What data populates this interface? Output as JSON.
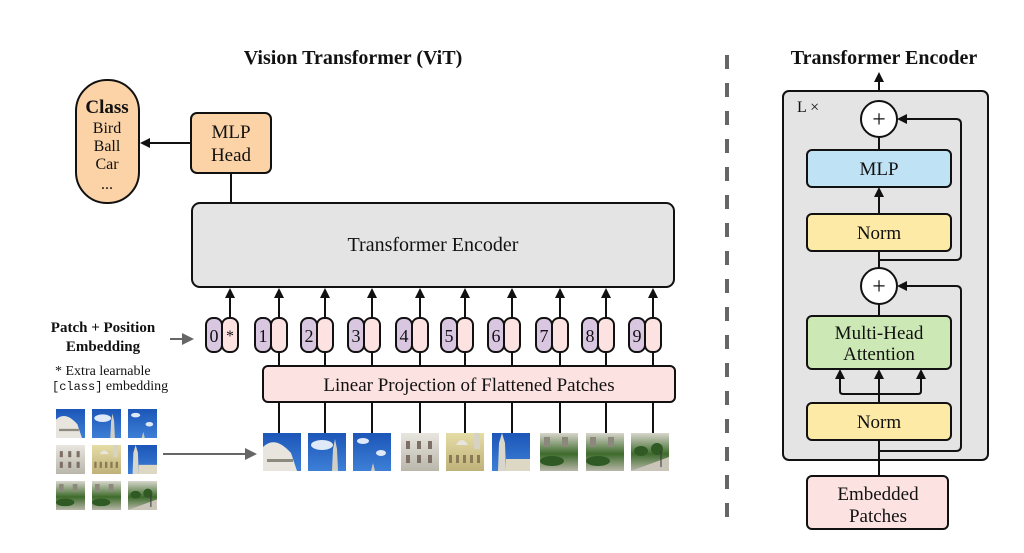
{
  "vit": {
    "title": "Vision Transformer (ViT)",
    "class_box": {
      "title": "Class",
      "items": [
        "Bird",
        "Ball",
        "Car",
        "..."
      ]
    },
    "mlp_head": [
      "MLP",
      "Head"
    ],
    "transformer_encoder": "Transformer Encoder",
    "patch_position_label": [
      "Patch + Position",
      "Embedding"
    ],
    "extra_note": {
      "line1": "* Extra learnable",
      "code": "[class]",
      "rest": " embedding"
    },
    "tokens": [
      "0",
      "1",
      "2",
      "3",
      "4",
      "5",
      "6",
      "7",
      "8",
      "9"
    ],
    "class_token_symbol": "*",
    "linear_projection": "Linear Projection of Flattened Patches",
    "patch_count": 9
  },
  "encoder": {
    "title": "Transformer Encoder",
    "repeat_label": "L ×",
    "add_symbol": "+",
    "mlp": "MLP",
    "norm": "Norm",
    "mha": [
      "Multi-Head",
      "Attention"
    ],
    "embedded_patches": [
      "Embedded",
      "Patches"
    ]
  },
  "colors": {
    "orange": "#fbd3a6",
    "gray": "#e4e4e4",
    "pink": "#fde2e2",
    "purple": "#d9c6e0",
    "blue": "#c0e2f5",
    "yellow": "#fdeaa7",
    "green": "#cce8b5"
  }
}
